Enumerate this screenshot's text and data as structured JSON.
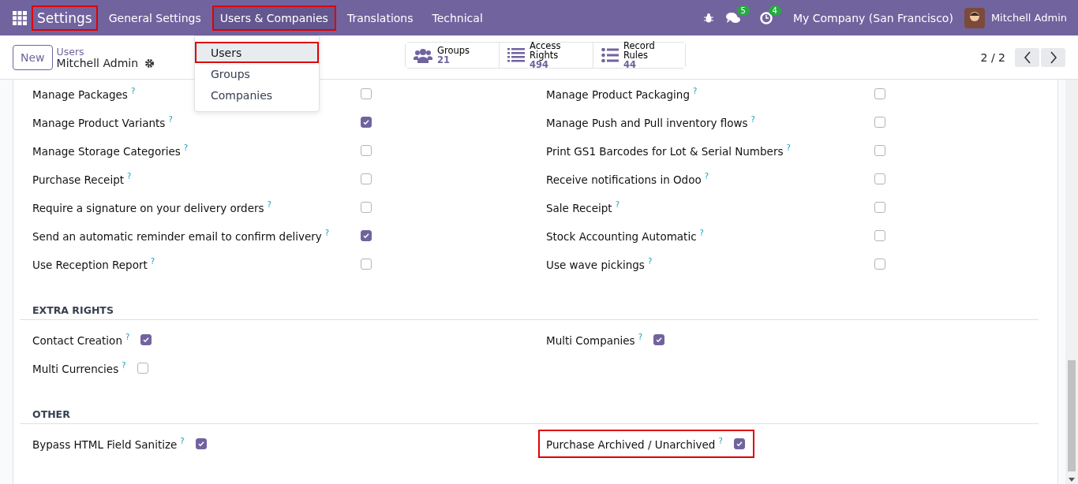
{
  "navbar": {
    "menus": [
      {
        "label": "Settings",
        "kind": "brand",
        "highlighted": true,
        "expanded": false
      },
      {
        "label": "General Settings",
        "kind": "menu",
        "highlighted": false,
        "expanded": false
      },
      {
        "label": "Users & Companies",
        "kind": "menu",
        "highlighted": true,
        "expanded": true
      },
      {
        "label": "Translations",
        "kind": "menu",
        "highlighted": false,
        "expanded": false
      },
      {
        "label": "Technical",
        "kind": "menu",
        "highlighted": false,
        "expanded": false
      }
    ],
    "chat_count": "5",
    "activity_count": "4",
    "company": "My Company (San Francisco)",
    "user": "Mitchell Admin"
  },
  "dropdown": {
    "items": [
      {
        "label": "Users",
        "selected": true,
        "highlighted": true
      },
      {
        "label": "Groups",
        "selected": false,
        "highlighted": false
      },
      {
        "label": "Companies",
        "selected": false,
        "highlighted": false
      }
    ]
  },
  "control_panel": {
    "new_button": "New",
    "breadcrumb": "Users",
    "record": "Mitchell Admin",
    "smart_buttons": [
      {
        "label": "Groups",
        "count": "21",
        "kind": "groups"
      },
      {
        "label": "Access Rights",
        "count": "494",
        "kind": "list"
      },
      {
        "label": "Record Rules",
        "count": "44",
        "kind": "rules"
      }
    ],
    "pager": "2 / 2"
  },
  "sections": [
    {
      "kind": "grid",
      "columns": [
        [
          {
            "label": "Manage Packages",
            "help": "?",
            "checked": false,
            "highlighted": false
          },
          {
            "label": "Manage Product Variants",
            "help": "?",
            "checked": true,
            "highlighted": false
          },
          {
            "label": "Manage Storage Categories",
            "help": "?",
            "checked": false,
            "highlighted": false
          },
          {
            "label": "Purchase Receipt",
            "help": "?",
            "checked": false,
            "highlighted": false
          },
          {
            "label": "Require a signature on your delivery orders",
            "help": "?",
            "checked": false,
            "highlighted": false
          },
          {
            "label": "Send an automatic reminder email to confirm delivery",
            "help": "?",
            "checked": true,
            "highlighted": false
          },
          {
            "label": "Use Reception Report",
            "help": "?",
            "checked": false,
            "highlighted": false
          }
        ],
        [
          {
            "label": "Manage Product Packaging",
            "help": "?",
            "checked": false,
            "highlighted": false
          },
          {
            "label": "Manage Push and Pull inventory flows",
            "help": "?",
            "checked": false,
            "highlighted": false
          },
          {
            "label": "Print GS1 Barcodes for Lot & Serial Numbers",
            "help": "?",
            "checked": false,
            "highlighted": false
          },
          {
            "label": "Receive notifications in Odoo",
            "help": "?",
            "checked": false,
            "highlighted": false
          },
          {
            "label": "Sale Receipt",
            "help": "?",
            "checked": false,
            "highlighted": false
          },
          {
            "label": "Stock Accounting Automatic",
            "help": "?",
            "checked": false,
            "highlighted": false
          },
          {
            "label": "Use wave pickings",
            "help": "?",
            "checked": false,
            "highlighted": false
          }
        ]
      ]
    },
    {
      "kind": "inline",
      "title": "EXTRA RIGHTS",
      "columns": [
        [
          {
            "label": "Contact Creation",
            "help": "?",
            "checked": true,
            "highlighted": false
          },
          {
            "label": "Multi Currencies",
            "help": "?",
            "checked": false,
            "highlighted": false
          }
        ],
        [
          {
            "label": "Multi Companies",
            "help": "?",
            "checked": true,
            "highlighted": false
          }
        ]
      ]
    },
    {
      "kind": "inline",
      "title": "OTHER",
      "columns": [
        [
          {
            "label": "Bypass HTML Field Sanitize",
            "help": "?",
            "checked": true,
            "highlighted": false
          }
        ],
        [
          {
            "label": "Purchase Archived / Unarchived",
            "help": "?",
            "checked": true,
            "highlighted": true
          }
        ]
      ]
    }
  ]
}
